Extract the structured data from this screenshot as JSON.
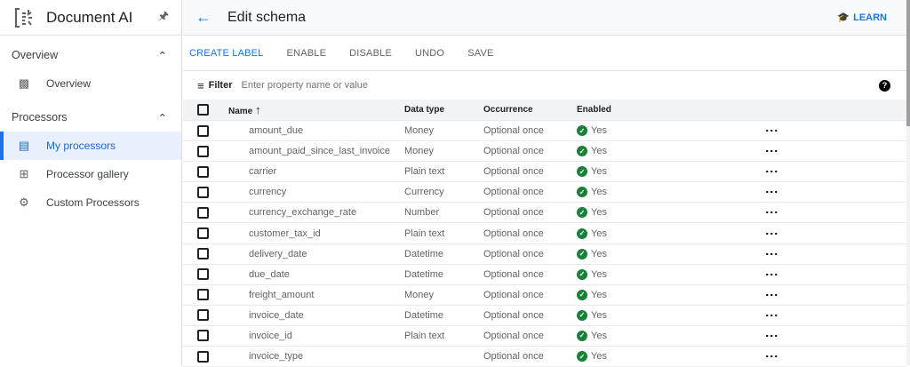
{
  "sidebar": {
    "app_title": "Document AI",
    "sections": [
      {
        "label": "Overview",
        "items": [
          {
            "label": "Overview"
          }
        ]
      },
      {
        "label": "Processors",
        "items": [
          {
            "label": "My processors"
          },
          {
            "label": "Processor gallery"
          },
          {
            "label": "Custom Processors"
          }
        ]
      }
    ]
  },
  "header": {
    "title": "Edit schema",
    "learn": "LEARN"
  },
  "toolbar": {
    "create_label": "CREATE LABEL",
    "enable": "ENABLE",
    "disable": "DISABLE",
    "undo": "UNDO",
    "save": "SAVE"
  },
  "filter": {
    "label": "Filter",
    "placeholder": "Enter property name or value",
    "help": "?"
  },
  "table": {
    "headers": {
      "name": "Name",
      "data_type": "Data type",
      "occurrence": "Occurrence",
      "enabled": "Enabled"
    },
    "rows": [
      {
        "name": "amount_due",
        "type": "Money",
        "occ": "Optional once",
        "en": "Yes"
      },
      {
        "name": "amount_paid_since_last_invoice",
        "type": "Money",
        "occ": "Optional once",
        "en": "Yes"
      },
      {
        "name": "carrier",
        "type": "Plain text",
        "occ": "Optional once",
        "en": "Yes"
      },
      {
        "name": "currency",
        "type": "Currency",
        "occ": "Optional once",
        "en": "Yes"
      },
      {
        "name": "currency_exchange_rate",
        "type": "Number",
        "occ": "Optional once",
        "en": "Yes"
      },
      {
        "name": "customer_tax_id",
        "type": "Plain text",
        "occ": "Optional once",
        "en": "Yes"
      },
      {
        "name": "delivery_date",
        "type": "Datetime",
        "occ": "Optional once",
        "en": "Yes"
      },
      {
        "name": "due_date",
        "type": "Datetime",
        "occ": "Optional once",
        "en": "Yes"
      },
      {
        "name": "freight_amount",
        "type": "Money",
        "occ": "Optional once",
        "en": "Yes"
      },
      {
        "name": "invoice_date",
        "type": "Datetime",
        "occ": "Optional once",
        "en": "Yes"
      },
      {
        "name": "invoice_id",
        "type": "Plain text",
        "occ": "Optional once",
        "en": "Yes"
      },
      {
        "name": "invoice_type",
        "type": "",
        "occ": "Optional once",
        "en": "Yes"
      }
    ]
  }
}
